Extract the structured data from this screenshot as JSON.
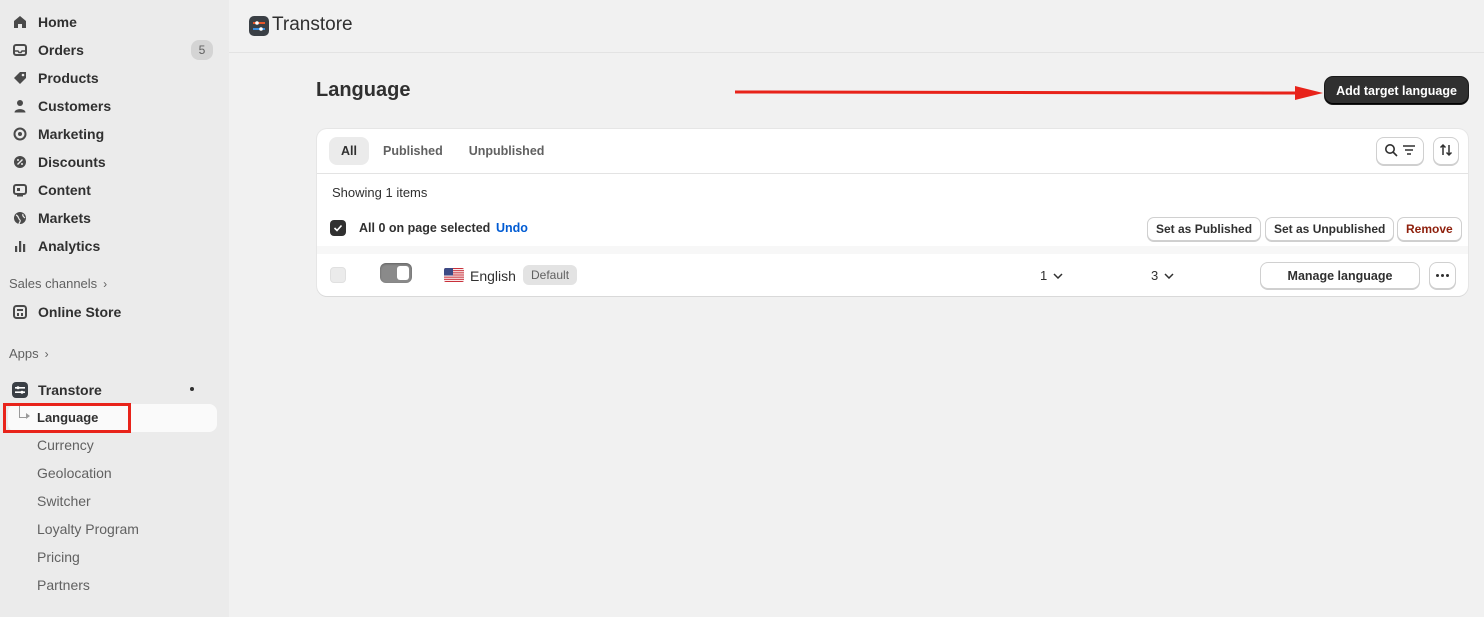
{
  "sidebar": {
    "nav": [
      {
        "label": "Home",
        "icon": "home-icon"
      },
      {
        "label": "Orders",
        "icon": "inbox-icon",
        "badge": "5"
      },
      {
        "label": "Products",
        "icon": "tag-icon"
      },
      {
        "label": "Customers",
        "icon": "person-icon"
      },
      {
        "label": "Marketing",
        "icon": "target-icon"
      },
      {
        "label": "Discounts",
        "icon": "discount-icon"
      },
      {
        "label": "Content",
        "icon": "content-icon"
      },
      {
        "label": "Markets",
        "icon": "globe-icon"
      },
      {
        "label": "Analytics",
        "icon": "bar-chart-icon"
      }
    ],
    "sales_channels_label": "Sales channels",
    "online_store_label": "Online Store",
    "apps_label": "Apps",
    "app_name": "Transtore",
    "app_sub_items": [
      "Language",
      "Currency",
      "Geolocation",
      "Switcher",
      "Loyalty Program",
      "Pricing",
      "Partners"
    ]
  },
  "header": {
    "app_title": "Transtore"
  },
  "page": {
    "title": "Language",
    "primary_action": "Add target language"
  },
  "card": {
    "tabs": [
      "All",
      "Published",
      "Unpublished"
    ],
    "active_tab": "All",
    "showing_text": "Showing 1 items",
    "bulk": {
      "selected_text": "All 0 on page selected",
      "undo_label": "Undo",
      "set_published": "Set as Published",
      "set_unpublished": "Set as Unpublished",
      "remove": "Remove"
    },
    "rows": [
      {
        "language": "English",
        "badge": "Default",
        "count_a": "1",
        "count_b": "3",
        "manage_label": "Manage language"
      }
    ]
  },
  "colors": {
    "primary_button": "#303030",
    "annotation_red": "#e8231a",
    "link_blue": "#005bd3",
    "danger": "#8e1f0b"
  }
}
